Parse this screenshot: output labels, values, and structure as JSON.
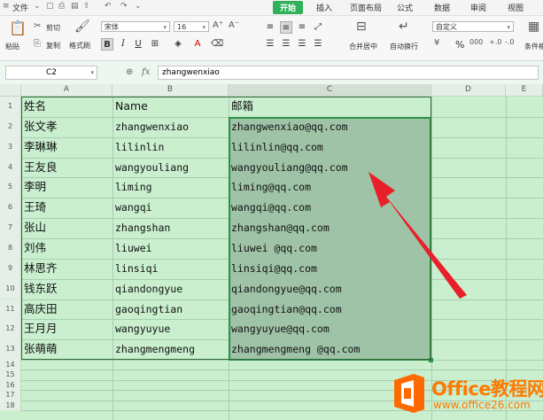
{
  "menubar": {
    "file_label": "文件",
    "tabs": [
      {
        "label": "开始",
        "active": true
      },
      {
        "label": "插入"
      },
      {
        "label": "页面布局"
      },
      {
        "label": "公式"
      },
      {
        "label": "数据"
      },
      {
        "label": "审阅"
      },
      {
        "label": "视图"
      }
    ]
  },
  "ribbon": {
    "paste": "粘贴",
    "cut": "剪切",
    "copy": "复制",
    "format_painter": "格式刷",
    "font_name": "宋体",
    "font_size": "16",
    "merge_center": "合并居中",
    "wrap_text": "自动换行",
    "number_format": "自定义",
    "percent": "%",
    "conditional": "条件格"
  },
  "formula_bar": {
    "name_box": "C2",
    "fx_label": "fx",
    "value": "zhangwenxiao"
  },
  "columns": [
    "A",
    "B",
    "C",
    "D",
    "E"
  ],
  "rows": [
    "1",
    "2",
    "3",
    "4",
    "5",
    "6",
    "7",
    "8",
    "9",
    "10",
    "11",
    "12",
    "13",
    "14",
    "15",
    "16",
    "17",
    "18"
  ],
  "table": {
    "headers": [
      "姓名",
      "Name",
      "邮箱"
    ],
    "rows": [
      [
        "张文孝",
        "zhangwenxiao",
        "zhangwenxiao@qq.com"
      ],
      [
        "李琳琳",
        "lilinlin",
        "lilinlin@qq.com"
      ],
      [
        "王友良",
        "wangyouliang",
        "wangyouliang@qq.com"
      ],
      [
        "李明",
        "liming",
        "liming@qq.com"
      ],
      [
        "王琦",
        "wangqi",
        "wangqi@qq.com"
      ],
      [
        "张山",
        "zhangshan",
        "zhangshan@qq.com"
      ],
      [
        "刘伟",
        "liuwei",
        "liuwei @qq.com"
      ],
      [
        "林思齐",
        "linsiqi",
        "linsiqi@qq.com"
      ],
      [
        "钱东跃",
        "qiandongyue",
        "qiandongyue@qq.com"
      ],
      [
        "高庆田",
        "gaoqingtian",
        "gaoqingtian@qq.com"
      ],
      [
        "王月月",
        "wangyuyue",
        "wangyuyue@qq.com"
      ],
      [
        "张萌萌",
        "zhangmengmeng",
        "zhangmengmeng @qq.com"
      ]
    ]
  },
  "watermark": {
    "brand": "Office教程网",
    "url": "www.office26.com"
  },
  "colors": {
    "accent": "#2fb05a",
    "arrow": "#e8202a",
    "logo": "#ff7a00"
  }
}
